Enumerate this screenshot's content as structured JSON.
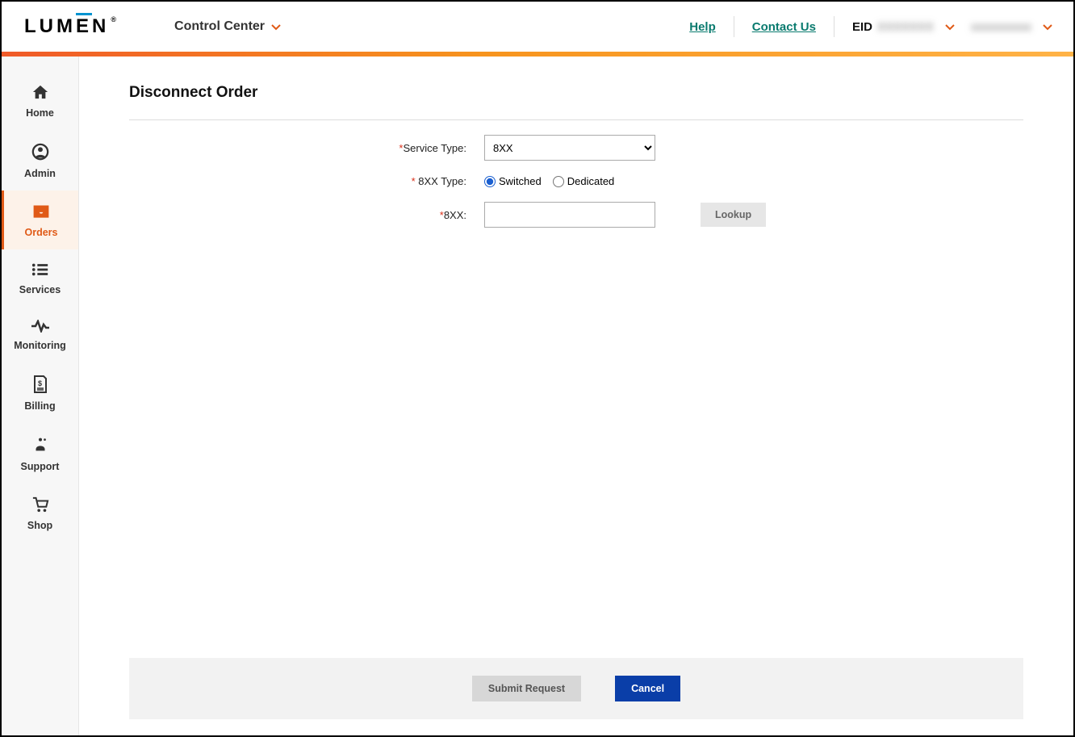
{
  "header": {
    "logo_text": "LUMEN",
    "menu_label": "Control Center",
    "help_label": "Help",
    "contact_label": "Contact Us",
    "eid_label": "EID",
    "eid_value": "XXXXXXX",
    "user_value": "xxxxxxxxxx"
  },
  "sidebar": {
    "items": [
      {
        "label": "Home"
      },
      {
        "label": "Admin"
      },
      {
        "label": "Orders"
      },
      {
        "label": "Services"
      },
      {
        "label": "Monitoring"
      },
      {
        "label": "Billing"
      },
      {
        "label": "Support"
      },
      {
        "label": "Shop"
      }
    ]
  },
  "page": {
    "title": "Disconnect Order",
    "form": {
      "service_type_label": "Service Type:",
      "service_type_value": "8XX",
      "eightxx_type_label": "8XX Type:",
      "radio_switched": "Switched",
      "radio_dedicated": "Dedicated",
      "eightxx_label": "8XX:",
      "eightxx_value": "",
      "lookup_label": "Lookup"
    },
    "footer": {
      "submit_label": "Submit Request",
      "cancel_label": "Cancel"
    }
  }
}
